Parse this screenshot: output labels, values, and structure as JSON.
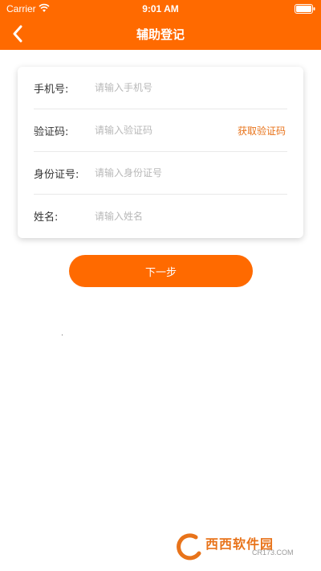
{
  "status_bar": {
    "carrier": "Carrier",
    "time": "9:01 AM"
  },
  "nav": {
    "title": "辅助登记",
    "back_icon": "chevron-left-icon"
  },
  "form": {
    "rows": [
      {
        "label": "手机号:",
        "placeholder": "请输入手机号",
        "value": ""
      },
      {
        "label": "验证码:",
        "placeholder": "请输入验证码",
        "value": "",
        "action": "获取验证码"
      },
      {
        "label": "身份证号:",
        "placeholder": "请输入身份证号",
        "value": ""
      },
      {
        "label": "姓名:",
        "placeholder": "请输入姓名",
        "value": ""
      }
    ]
  },
  "next_button": {
    "label": "下一步"
  },
  "watermark": {
    "brand": "西西软件园",
    "domain": "CR173.COM"
  },
  "colors": {
    "accent": "#ff6a00",
    "link": "#e8731a",
    "placeholder": "#b8b8b8"
  }
}
